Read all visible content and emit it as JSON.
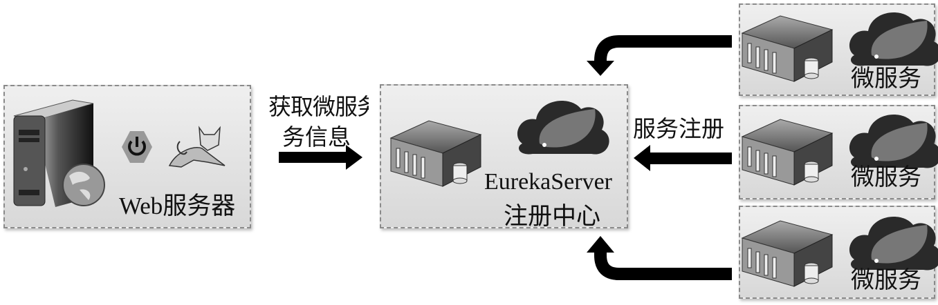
{
  "web_server": {
    "label": "Web服务器"
  },
  "fetch_label": {
    "line1": "获取微服务",
    "line2": "务信息"
  },
  "eureka": {
    "name": "EurekaServer",
    "subtitle": "注册中心"
  },
  "register_label": "服务注册",
  "microservices": [
    {
      "label": "微服务"
    },
    {
      "label": "微服务"
    },
    {
      "label": "微服务"
    }
  ]
}
